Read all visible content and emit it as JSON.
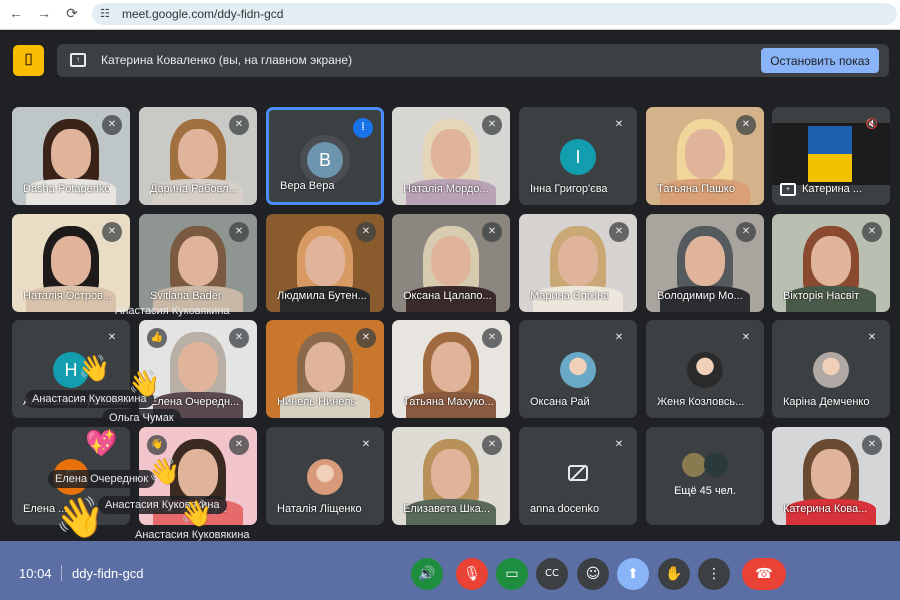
{
  "browser": {
    "url": "meet.google.com/ddy-fidn-gcd",
    "back_icon": "←",
    "forward_icon": "→",
    "reload_icon": "⟳"
  },
  "banner": {
    "text": "Катерина Коваленко (вы, на главном экране)",
    "stop_label": "Остановить показ"
  },
  "colors": {
    "accent": "#8ab4f8",
    "speaking": "#1a73e8",
    "end_call": "#ea4335",
    "green": "#1e8e3e",
    "muted": "#ea4335",
    "bar": "#5b6fa4"
  },
  "tiles": [
    {
      "name": "Dasha Potapenko",
      "type": "video",
      "bg": "#bfc6c8",
      "hair": "#3a2318",
      "shirt": "#e8e4e0",
      "mic": "muted"
    },
    {
      "name": "Дарина Рабовл...",
      "type": "video",
      "bg": "#c9c9c6",
      "hair": "#a07040",
      "shirt": "#d5cfc8",
      "mic": "muted"
    },
    {
      "name": "Вера Вера",
      "type": "avatar",
      "letter": "B",
      "avatar_color": "#6b96ad",
      "mic": "speaking",
      "speaking": true
    },
    {
      "name": "Наталія Мордо...",
      "type": "video",
      "bg": "#d8d6d2",
      "hair": "#e6d6b8",
      "shirt": "#b9a2b6",
      "mic": "muted"
    },
    {
      "name": "Інна Григор'єва",
      "type": "avatar",
      "letter": "I",
      "avatar_color": "#129eaf",
      "mic": "muted"
    },
    {
      "name": "Татьяна Пашко",
      "type": "video",
      "bg": "#d4b38a",
      "hair": "#f0d69a",
      "shirt": "#d9a078",
      "mic": "muted"
    },
    {
      "name": "Катерина ...",
      "type": "presentation",
      "mic": "volume-off"
    },
    {
      "name": "Наталія Остров...",
      "type": "video",
      "bg": "#e9ddc6",
      "hair": "#1e1a1a",
      "shirt": "#d9c2ac",
      "mic": "muted"
    },
    {
      "name": "Svitlana Bader",
      "type": "video",
      "bg": "#8f9692",
      "hair": "#7a5a40",
      "shirt": "#c9b8a6",
      "mic": "muted"
    },
    {
      "name": "Людмила Бутен...",
      "type": "video",
      "bg": "#8a5b2c",
      "hair": "#d69a62",
      "shirt": "#2a2a2a",
      "mic": "muted"
    },
    {
      "name": "Оксана Цалапо...",
      "type": "video",
      "bg": "#8c8680",
      "hair": "#d8ccb0",
      "shirt": "#3a2a2a",
      "mic": "muted"
    },
    {
      "name": "Марина Єпіхіна",
      "type": "video",
      "bg": "#d6d3d0",
      "hair": "#c9a876",
      "shirt": "#ece6dc",
      "mic": "muted"
    },
    {
      "name": "Володимир Мо...",
      "type": "video",
      "bg": "#a9a49d",
      "hair": "#555a5e",
      "shirt": "#2b2d30",
      "mic": "muted"
    },
    {
      "name": "Вікторія Насвіт",
      "type": "video",
      "bg": "#b9c0b2",
      "hair": "#8a4a30",
      "shirt": "#4a5a4a",
      "mic": "muted"
    },
    {
      "name": "Анастасия Куковякина",
      "type": "avatar",
      "letter": "H",
      "avatar_color": "#129eaf",
      "mic": "muted"
    },
    {
      "name": "Елена Очередн...",
      "type": "video",
      "bg": "#e4e4e4",
      "hair": "#b8b0a6",
      "shirt": "#5a4a50",
      "mic": "muted",
      "reaction": "👍"
    },
    {
      "name": "Нинель Нинель",
      "type": "video",
      "bg": "#c9772c",
      "hair": "#8a6a4a",
      "shirt": "#d8d0c0",
      "mic": "muted"
    },
    {
      "name": "Татьяна Махуко...",
      "type": "video",
      "bg": "#e8e4e0",
      "hair": "#a06a40",
      "shirt": "#8a5a40",
      "mic": "muted"
    },
    {
      "name": "Оксана Рай",
      "type": "photo",
      "avatar_color": "#6aa8c8",
      "mic": "muted"
    },
    {
      "name": "Женя Козловсь...",
      "type": "photo",
      "avatar_color": "#2a2a2a",
      "mic": "muted"
    },
    {
      "name": "Каріна Демченко",
      "type": "photo",
      "avatar_color": "#b0a8a4",
      "mic": "muted"
    },
    {
      "name": "Елена ...",
      "type": "avatar",
      "letter": "E",
      "avatar_color": "#e8710a",
      "mic": "none"
    },
    {
      "name": "Анастасия Ку...",
      "type": "video",
      "bg": "#f2c4cc",
      "hair": "#3a2a20",
      "shirt": "#e66a6a",
      "mic": "muted",
      "reaction": "👋"
    },
    {
      "name": "Наталія Ліщенко",
      "type": "photo",
      "avatar_color": "#d89a7a",
      "mic": "muted"
    },
    {
      "name": "Елизавета Шка...",
      "type": "video",
      "bg": "#dedad4",
      "hair": "#b8905a",
      "shirt": "#5a6a5a",
      "mic": "muted"
    },
    {
      "name": "anna docenko",
      "type": "camera-off",
      "mic": "muted"
    },
    {
      "name": "Ещё 45 чел.",
      "type": "more"
    },
    {
      "name": "Катерина Кова...",
      "type": "video",
      "bg": "#d4d6d8",
      "hair": "#6a4a30",
      "shirt": "#d8323a",
      "mic": "muted"
    }
  ],
  "overlays": {
    "labels": [
      "Анастасия Куковякина",
      "Анастасия Куковякина",
      "Ольга Чумак",
      "Елена Очереднюк",
      "Анастасия Куковякина",
      "Анастасия Куковякина"
    ],
    "emojis": [
      "👋",
      "👋",
      "💖",
      "👋",
      "👋",
      "👋"
    ]
  },
  "controls": {
    "time": "10:04",
    "meeting_code": "ddy-fidn-gcd",
    "buttons": [
      {
        "name": "speaker-button",
        "icon": "🔊",
        "color": "#1e8e3e"
      },
      {
        "name": "microphone-button",
        "icon": "🎙",
        "color": "#ea4335"
      },
      {
        "name": "camera-button",
        "icon": "▭",
        "color": "#1e8e3e"
      },
      {
        "name": "captions-button",
        "icon": "CC",
        "color": "#3c4043"
      },
      {
        "name": "reactions-button",
        "icon": "☺",
        "color": "#3c4043"
      },
      {
        "name": "present-button",
        "icon": "⬆",
        "color": "#8ab4f8"
      },
      {
        "name": "raise-hand-button",
        "icon": "✋",
        "color": "#3c4043"
      },
      {
        "name": "more-options-button",
        "icon": "⋮",
        "color": "#3c4043"
      },
      {
        "name": "end-call-button",
        "icon": "☎",
        "color": "#ea4335"
      }
    ]
  }
}
